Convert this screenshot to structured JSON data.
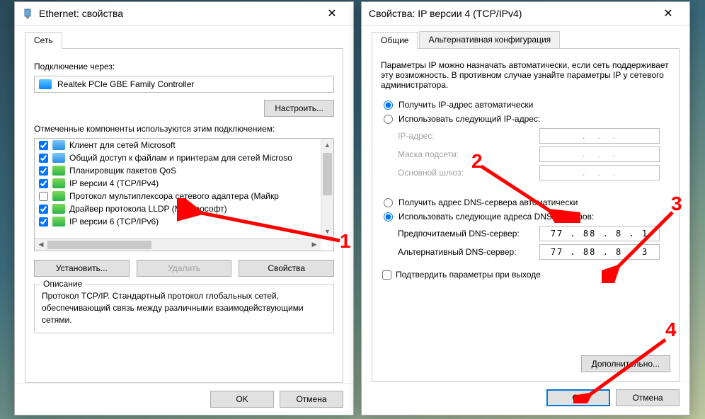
{
  "left": {
    "title": "Ethernet: свойства",
    "tab_network": "Сеть",
    "connect_via_label": "Подключение через:",
    "adapter_name": "Realtek PCIe GBE Family Controller",
    "configure_btn": "Настроить...",
    "components_label": "Отмеченные компоненты используются этим подключением:",
    "items": [
      {
        "checked": true,
        "label": "Клиент для сетей Microsoft"
      },
      {
        "checked": true,
        "label": "Общий доступ к файлам и принтерам для сетей Microso"
      },
      {
        "checked": true,
        "label": "Планировщик пакетов QoS"
      },
      {
        "checked": true,
        "label": "IP версии 4 (TCP/IPv4)"
      },
      {
        "checked": false,
        "label": "Протокол мультиплексора сетевого адаптера (Майкр"
      },
      {
        "checked": true,
        "label": "Драйвер протокола LLDP (Майкрософт)"
      },
      {
        "checked": true,
        "label": "IP версии 6 (TCP/IPv6)"
      }
    ],
    "install_btn": "Установить...",
    "remove_btn": "Удалить",
    "props_btn": "Свойства",
    "desc_title": "Описание",
    "desc_text": "Протокол TCP/IP. Стандартный протокол глобальных сетей, обеспечивающий связь между различными взаимодействующими сетями.",
    "ok": "OK",
    "cancel": "Отмена"
  },
  "right": {
    "title": "Свойства: IP версии 4 (TCP/IPv4)",
    "tab_general": "Общие",
    "tab_alt": "Альтернативная конфигурация",
    "info": "Параметры IP можно назначать автоматически, если сеть поддерживает эту возможность. В противном случае узнайте параметры IP у сетевого администратора.",
    "radio_ip_auto": "Получить IP-адрес автоматически",
    "radio_ip_manual": "Использовать следующий IP-адрес:",
    "lbl_ip": "IP-адрес:",
    "lbl_mask": "Маска подсети:",
    "lbl_gw": "Основной шлюз:",
    "radio_dns_auto": "Получить адрес DNS-сервера автоматически",
    "radio_dns_manual": "Использовать следующие адреса DNS-серверов:",
    "lbl_dns1": "Предпочитаемый DNS-сервер:",
    "lbl_dns2": "Альтернативный DNS-сервер:",
    "dns1": "77 . 88 .  8 .  1",
    "dns2": "77 . 88 .  8 .  3",
    "validate": "Подтвердить параметры при выходе",
    "advanced": "Дополнительно...",
    "ok": "OK",
    "cancel": "Отмена"
  },
  "annotations": {
    "n1": "1",
    "n2": "2",
    "n3": "3",
    "n4": "4"
  }
}
